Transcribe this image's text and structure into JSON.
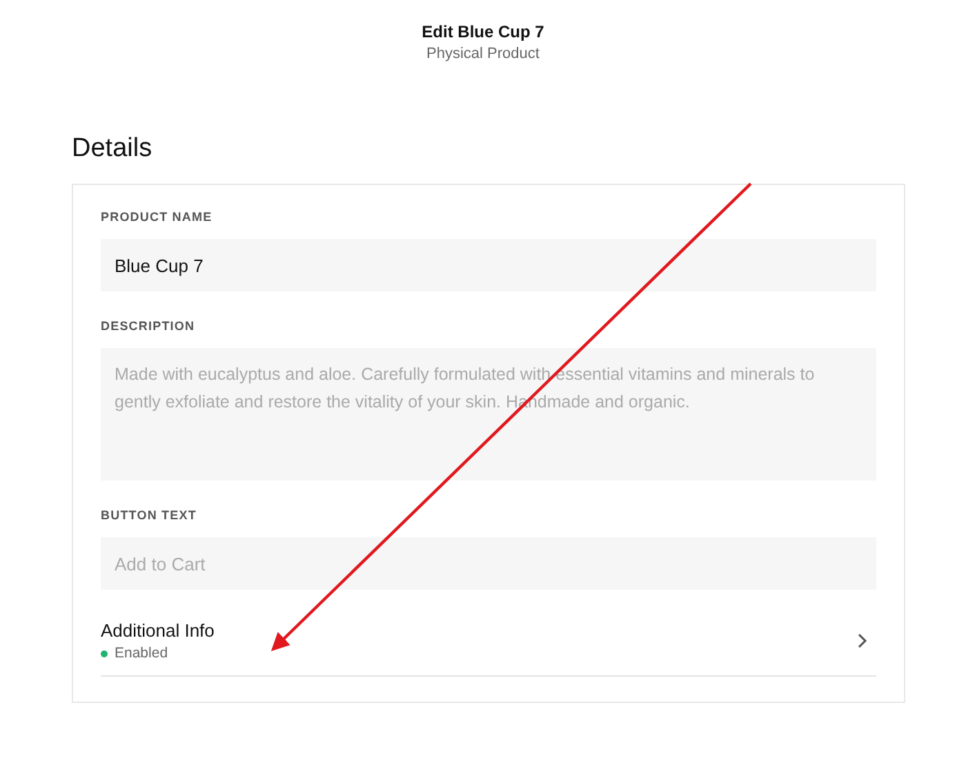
{
  "header": {
    "title": "Edit Blue Cup 7",
    "subtitle": "Physical Product"
  },
  "section": {
    "title": "Details"
  },
  "fields": [
    {
      "kind": "input",
      "label": "PRODUCT NAME",
      "value": "Blue Cup 7"
    },
    {
      "kind": "textarea",
      "label": "DESCRIPTION",
      "placeholder": "Made with eucalyptus and aloe. Carefully formulated with essential vitamins and minerals to gently exfoliate and restore the vitality of your skin. Handmade and organic."
    },
    {
      "kind": "input",
      "label": "BUTTON TEXT",
      "placeholder": "Add to Cart"
    }
  ],
  "additional_info": {
    "title": "Additional Info",
    "status": "Enabled",
    "color": "#1fb46e"
  }
}
